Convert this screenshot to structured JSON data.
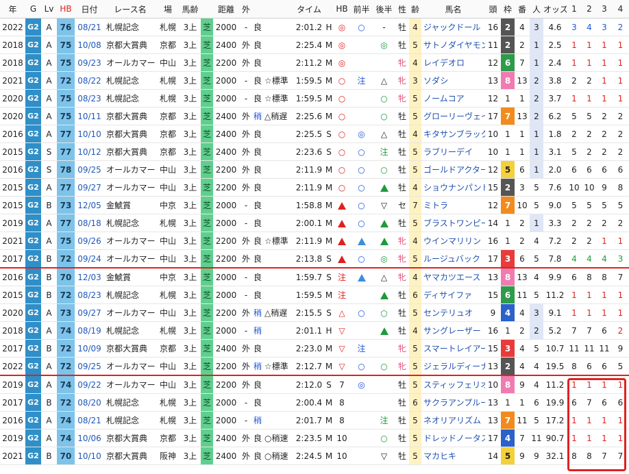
{
  "headers": [
    "年",
    "G",
    "Lv",
    "HB",
    "日付",
    "レース名",
    "場",
    "馬齢",
    "",
    "距離",
    "外",
    "",
    "",
    "タイム",
    "",
    "HB",
    "前半",
    "後半",
    "性",
    "齢",
    "馬名",
    "頭",
    "枠",
    "番",
    "人",
    "オッズ",
    "1",
    "2",
    "3",
    "4"
  ],
  "rows": [
    {
      "c": [
        "2022",
        "G2",
        "A",
        "76",
        "08/21",
        "札幌記念",
        "札幌",
        "3上",
        "芝",
        "2000",
        "-",
        "良",
        "",
        "2:01.2",
        "H",
        "◎",
        "○",
        "-",
        "牡",
        "4",
        "ジャックドール",
        "16",
        "2",
        "4",
        "3",
        "4.6",
        "3",
        "4",
        "3",
        "2"
      ],
      "w": "2",
      "ps": [
        "blue",
        "blue",
        "blue",
        "blue"
      ]
    },
    {
      "c": [
        "2018",
        "G2",
        "A",
        "75",
        "10/08",
        "京都大賞典",
        "京都",
        "3上",
        "芝",
        "2400",
        "外",
        "良",
        "",
        "2:25.4",
        "M",
        "◎",
        "",
        "◎",
        "牡",
        "5",
        "サトノダイヤモンド",
        "11",
        "2",
        "2",
        "1",
        "2.5",
        "1",
        "1",
        "1",
        "1"
      ],
      "w": "2",
      "ps": [
        "red",
        "red",
        "red",
        "red"
      ]
    },
    {
      "c": [
        "2018",
        "G2",
        "A",
        "75",
        "09/23",
        "オールカマー",
        "中山",
        "3上",
        "芝",
        "2200",
        "外",
        "良",
        "",
        "2:11.2",
        "M",
        "◎",
        "",
        "",
        "牝",
        "4",
        "レイデオロ",
        "12",
        "6",
        "7",
        "1",
        "2.4",
        "1",
        "1",
        "1",
        "1"
      ],
      "w": "6",
      "ps": [
        "red",
        "red",
        "red",
        "red"
      ]
    },
    {
      "c": [
        "2021",
        "G2",
        "A",
        "72",
        "08/22",
        "札幌記念",
        "札幌",
        "3上",
        "芝",
        "2000",
        "-",
        "良",
        "☆標準",
        "1:59.5",
        "M",
        "○",
        "注",
        "△",
        "牝",
        "3",
        "ソダシ",
        "13",
        "8",
        "13",
        "2",
        "3.8",
        "2",
        "2",
        "1",
        "1"
      ],
      "w": "8",
      "ps": [
        "",
        "",
        "red",
        "red"
      ]
    },
    {
      "c": [
        "2020",
        "G2",
        "A",
        "75",
        "08/23",
        "札幌記念",
        "札幌",
        "3上",
        "芝",
        "2000",
        "-",
        "良",
        "☆標準",
        "1:59.5",
        "M",
        "○",
        "",
        "○",
        "牝",
        "5",
        "ノームコア",
        "12",
        "1",
        "1",
        "2",
        "3.7",
        "1",
        "1",
        "1",
        "1"
      ],
      "w": "1",
      "ps": [
        "red",
        "red",
        "red",
        "red"
      ]
    },
    {
      "c": [
        "2020",
        "G2",
        "A",
        "75",
        "10/11",
        "京都大賞典",
        "京都",
        "3上",
        "芝",
        "2400",
        "外",
        "稍",
        "△稍遅",
        "2:25.6",
        "M",
        "○",
        "",
        "○",
        "牡",
        "5",
        "グローリーヴェイズ",
        "17",
        "7",
        "13",
        "2",
        "6.2",
        "5",
        "5",
        "2",
        "2"
      ],
      "w": "7",
      "ps": [
        "",
        "",
        "",
        ""
      ]
    },
    {
      "c": [
        "2016",
        "G2",
        "A",
        "77",
        "10/10",
        "京都大賞典",
        "京都",
        "3上",
        "芝",
        "2400",
        "外",
        "良",
        "",
        "2:25.5",
        "S",
        "○",
        "◎",
        "△",
        "牡",
        "4",
        "キタサンブラック",
        "10",
        "1",
        "1",
        "1",
        "1.8",
        "2",
        "2",
        "2",
        "2"
      ],
      "w": "1",
      "ps": [
        "",
        "",
        "",
        ""
      ]
    },
    {
      "c": [
        "2015",
        "G2",
        "S",
        "77",
        "10/12",
        "京都大賞典",
        "京都",
        "3上",
        "芝",
        "2400",
        "外",
        "良",
        "",
        "2:23.6",
        "S",
        "○",
        "○",
        "注",
        "牡",
        "5",
        "ラブリーデイ",
        "10",
        "1",
        "1",
        "1",
        "3.1",
        "5",
        "2",
        "2",
        "2"
      ],
      "w": "1",
      "ps": [
        "",
        "",
        "",
        ""
      ]
    },
    {
      "c": [
        "2016",
        "G2",
        "S",
        "78",
        "09/25",
        "オールカマー",
        "中山",
        "3上",
        "芝",
        "2200",
        "外",
        "良",
        "",
        "2:11.9",
        "M",
        "○",
        "○",
        "○",
        "牡",
        "5",
        "ゴールドアクター",
        "12",
        "5",
        "6",
        "1",
        "2.0",
        "6",
        "6",
        "6",
        "6"
      ],
      "w": "5",
      "ps": [
        "",
        "",
        "",
        ""
      ]
    },
    {
      "c": [
        "2015",
        "G2",
        "A",
        "77",
        "09/27",
        "オールカマー",
        "中山",
        "3上",
        "芝",
        "2200",
        "外",
        "良",
        "",
        "2:11.9",
        "M",
        "○",
        "○",
        "▲",
        "牡",
        "4",
        "ショウナンパンドラ",
        "15",
        "2",
        "3",
        "5",
        "7.6",
        "10",
        "10",
        "9",
        "8"
      ],
      "w": "2",
      "ps": [
        "",
        "",
        "",
        ""
      ]
    },
    {
      "c": [
        "2015",
        "G2",
        "B",
        "73",
        "12/05",
        "金鯱賞",
        "中京",
        "3上",
        "芝",
        "2000",
        "-",
        "良",
        "",
        "1:58.8",
        "M",
        "▲",
        "○",
        "▽",
        "セ",
        "7",
        "ミトラ",
        "12",
        "7",
        "10",
        "5",
        "9.0",
        "5",
        "5",
        "5",
        "5"
      ],
      "w": "7",
      "ps": [
        "",
        "",
        "",
        ""
      ]
    },
    {
      "c": [
        "2019",
        "G2",
        "A",
        "77",
        "08/18",
        "札幌記念",
        "札幌",
        "3上",
        "芝",
        "2000",
        "-",
        "良",
        "",
        "2:00.1",
        "M",
        "▲",
        "○",
        "▲",
        "牡",
        "5",
        "ブラストワンピース",
        "14",
        "1",
        "2",
        "1",
        "3.3",
        "2",
        "2",
        "2",
        "2"
      ],
      "w": "1",
      "ps": [
        "",
        "",
        "",
        ""
      ]
    },
    {
      "c": [
        "2021",
        "G2",
        "A",
        "75",
        "09/26",
        "オールカマー",
        "中山",
        "3上",
        "芝",
        "2200",
        "外",
        "良",
        "☆標準",
        "2:11.9",
        "M",
        "▲",
        "▲",
        "▲",
        "牝",
        "4",
        "ウインマリリン",
        "16",
        "1",
        "2",
        "4",
        "7.2",
        "2",
        "2",
        "1",
        "1"
      ],
      "w": "1",
      "ps": [
        "",
        "",
        "red",
        "red"
      ]
    },
    {
      "c": [
        "2017",
        "G2",
        "B",
        "72",
        "09/24",
        "オールカマー",
        "中山",
        "3上",
        "芝",
        "2200",
        "外",
        "良",
        "",
        "2:13.8",
        "S",
        "▲",
        "○",
        "◎",
        "牝",
        "5",
        "ルージュバック",
        "17",
        "3",
        "6",
        "5",
        "7.8",
        "4",
        "4",
        "4",
        "3"
      ],
      "w": "3",
      "ps": [
        "green",
        "green",
        "green",
        "green"
      ]
    },
    {
      "c": [
        "2016",
        "G2",
        "B",
        "70",
        "12/03",
        "金鯱賞",
        "中京",
        "3上",
        "芝",
        "2000",
        "-",
        "良",
        "",
        "1:59.7",
        "S",
        "注",
        "▲",
        "△",
        "牝",
        "4",
        "ヤマカツエース",
        "13",
        "8",
        "13",
        "4",
        "9.9",
        "6",
        "8",
        "8",
        "7"
      ],
      "w": "8",
      "ps": [
        "",
        "",
        "",
        ""
      ]
    },
    {
      "c": [
        "2015",
        "G2",
        "B",
        "72",
        "08/23",
        "札幌記念",
        "札幌",
        "3上",
        "芝",
        "2000",
        "-",
        "良",
        "",
        "1:59.5",
        "M",
        "注",
        "",
        "▲",
        "牡",
        "6",
        "ディサイファ",
        "15",
        "6",
        "11",
        "5",
        "11.2",
        "1",
        "1",
        "1",
        "1"
      ],
      "w": "6",
      "ps": [
        "red",
        "red",
        "red",
        "red"
      ]
    },
    {
      "c": [
        "2020",
        "G2",
        "A",
        "73",
        "09/27",
        "オールカマー",
        "中山",
        "3上",
        "芝",
        "2200",
        "外",
        "稍",
        "△稍遅",
        "2:15.5",
        "S",
        "△",
        "○",
        "○",
        "牡",
        "5",
        "センテリュオ",
        "9",
        "4",
        "4",
        "3",
        "9.1",
        "1",
        "1",
        "1",
        "1"
      ],
      "w": "4",
      "ps": [
        "red",
        "red",
        "red",
        "red"
      ]
    },
    {
      "c": [
        "2018",
        "G2",
        "A",
        "74",
        "08/19",
        "札幌記念",
        "札幌",
        "3上",
        "芝",
        "2000",
        "-",
        "稍",
        "",
        "2:01.1",
        "H",
        "▽",
        "",
        "▲",
        "牡",
        "4",
        "サングレーザー",
        "16",
        "1",
        "2",
        "2",
        "5.2",
        "7",
        "7",
        "6",
        "2"
      ],
      "w": "1",
      "ps": [
        "",
        "",
        "",
        "red"
      ]
    },
    {
      "c": [
        "2017",
        "G2",
        "B",
        "72",
        "10/09",
        "京都大賞典",
        "京都",
        "3上",
        "芝",
        "2400",
        "外",
        "良",
        "",
        "2:23.0",
        "M",
        "▽",
        "注",
        "",
        "牝",
        "5",
        "スマートレイアー",
        "15",
        "3",
        "4",
        "5",
        "10.7",
        "11",
        "11",
        "11",
        "9"
      ],
      "w": "3",
      "ps": [
        "",
        "",
        "",
        ""
      ]
    },
    {
      "c": [
        "2022",
        "G2",
        "A",
        "72",
        "09/25",
        "オールカマー",
        "中山",
        "3上",
        "芝",
        "2200",
        "外",
        "稍",
        "☆標準",
        "2:12.7",
        "M",
        "▽",
        "○",
        "○",
        "牝",
        "5",
        "ジェラルディーナ",
        "13",
        "2",
        "4",
        "4",
        "19.5",
        "8",
        "6",
        "6",
        "5"
      ],
      "w": "2",
      "ps": [
        "",
        "",
        "",
        ""
      ]
    },
    {
      "c": [
        "2019",
        "G2",
        "A",
        "74",
        "09/22",
        "オールカマー",
        "中山",
        "3上",
        "芝",
        "2200",
        "外",
        "良",
        "",
        "2:12.0",
        "S",
        "7",
        "◎",
        "",
        "牡",
        "5",
        "スティッフェリオ",
        "10",
        "8",
        "9",
        "4",
        "11.2",
        "1",
        "1",
        "1",
        "1"
      ],
      "w": "8",
      "ps": [
        "red",
        "red",
        "red",
        "red"
      ]
    },
    {
      "c": [
        "2017",
        "G2",
        "B",
        "72",
        "08/20",
        "札幌記念",
        "札幌",
        "3上",
        "芝",
        "2000",
        "-",
        "良",
        "",
        "2:00.4",
        "M",
        "8",
        "",
        "",
        "牡",
        "6",
        "サクラアンプルール",
        "13",
        "1",
        "1",
        "6",
        "19.9",
        "6",
        "7",
        "6",
        "6"
      ],
      "w": "1",
      "ps": [
        "",
        "",
        "",
        ""
      ]
    },
    {
      "c": [
        "2016",
        "G2",
        "A",
        "74",
        "08/21",
        "札幌記念",
        "札幌",
        "3上",
        "芝",
        "2000",
        "-",
        "稍",
        "",
        "2:01.7",
        "M",
        "8",
        "",
        "注",
        "牡",
        "5",
        "ネオリアリズム",
        "13",
        "7",
        "11",
        "5",
        "17.2",
        "1",
        "1",
        "1",
        "1"
      ],
      "w": "7",
      "ps": [
        "red",
        "red",
        "red",
        "red"
      ]
    },
    {
      "c": [
        "2019",
        "G2",
        "A",
        "74",
        "10/06",
        "京都大賞典",
        "京都",
        "3上",
        "芝",
        "2400",
        "外",
        "良",
        "○稍速",
        "2:23.5",
        "M",
        "10",
        "",
        "○",
        "牡",
        "5",
        "ドレッドノータス",
        "17",
        "4",
        "7",
        "11",
        "90.7",
        "1",
        "1",
        "1",
        "1"
      ],
      "w": "4",
      "ps": [
        "red",
        "red",
        "red",
        "red"
      ]
    },
    {
      "c": [
        "2021",
        "G2",
        "B",
        "70",
        "10/10",
        "京都大賞典",
        "阪神",
        "3上",
        "芝",
        "2400",
        "外",
        "良",
        "○稍速",
        "2:24.5",
        "M",
        "10",
        "",
        "▽",
        "牡",
        "5",
        "マカヒキ",
        "14",
        "5",
        "9",
        "9",
        "32.1",
        "8",
        "8",
        "7",
        "7"
      ],
      "w": "5",
      "ps": [
        "",
        "",
        "",
        ""
      ]
    }
  ]
}
